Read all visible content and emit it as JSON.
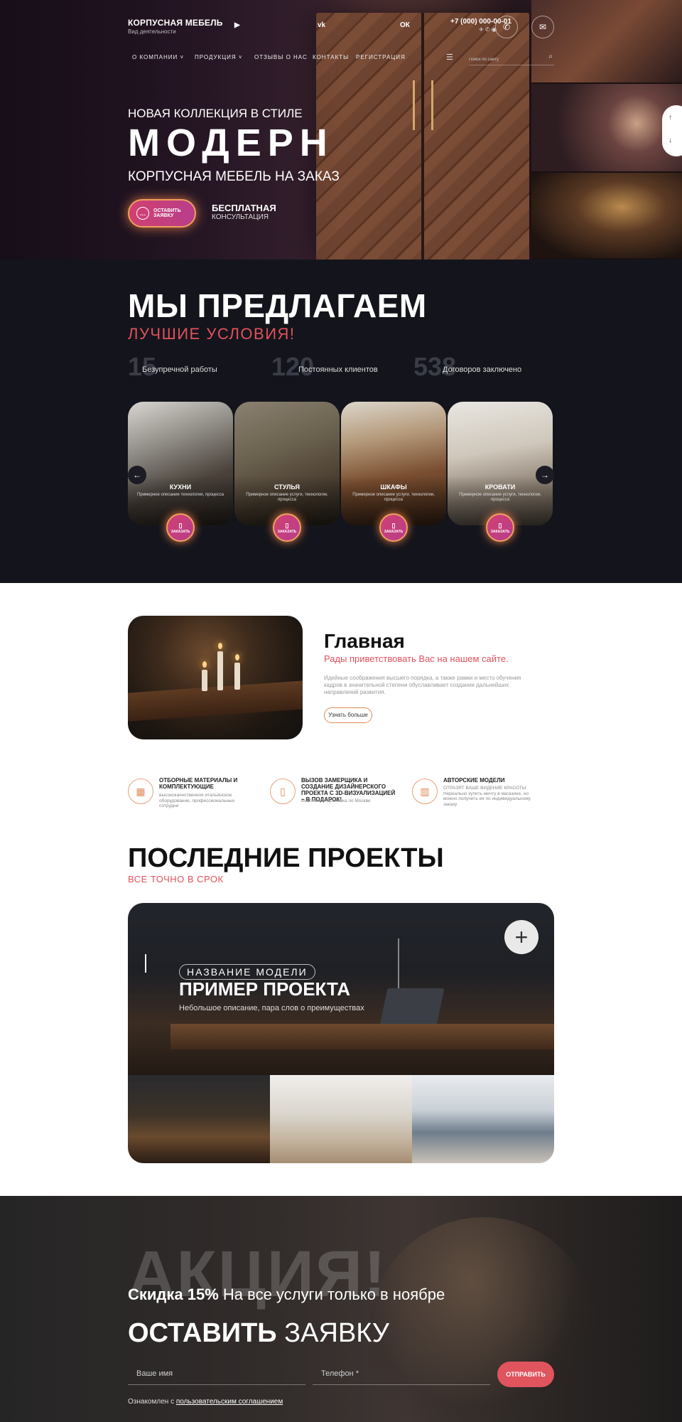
{
  "header": {
    "brand_name": "КОРПУСНАЯ МЕБЕЛЬ",
    "brand_sub": "Вид деятельности",
    "phone": "+7 (000) 000-00-01",
    "nav": [
      "О КОМПАНИИ",
      "ПРОДУКЦИЯ",
      "ОТЗЫВЫ О НАС",
      "КОНТАКТЫ",
      "РЕГИСТРАЦИЯ"
    ],
    "search_placeholder": "Поиск по сайту"
  },
  "hero": {
    "kicker": "НОВАЯ КОЛЛЕКЦИЯ В СТИЛЕ",
    "title": "МОДЕРН",
    "subtitle": "КОРПУСНАЯ МЕБЕЛЬ НА ЗАКАЗ",
    "cta_line1": "ОСТАВИТЬ",
    "cta_line2": "ЗАЯВКУ",
    "consult_line1": "БЕСПЛАТНАЯ",
    "consult_line2": "КОНСУЛЬТАЦИЯ"
  },
  "offer": {
    "title": "МЫ ПРЕДЛАГАЕМ",
    "subtitle": "ЛУЧШИЕ УСЛОВИЯ!",
    "stats": [
      {
        "num": "15",
        "label": "Безупречной работы"
      },
      {
        "num": "120",
        "label": "Постоянных клиентов"
      },
      {
        "num": "538",
        "label": "Договоров заключено"
      }
    ],
    "cards": [
      {
        "title": "КУХНИ",
        "desc": "Примерное описание технологии, процесса",
        "btn": "ЗАКАЗАТЬ"
      },
      {
        "title": "СТУЛЬЯ",
        "desc": "Примерное описание услуги, технологии, процесса",
        "btn": "ЗАКАЗАТЬ"
      },
      {
        "title": "ШКАФЫ",
        "desc": "Примерное описание услуги, технологии, процесса",
        "btn": "ЗАКАЗАТЬ"
      },
      {
        "title": "КРОВАТИ",
        "desc": "Примерное описание услуги, технологии, процесса",
        "btn": "ЗАКАЗАТЬ"
      }
    ]
  },
  "welcome": {
    "title": "Главная",
    "subtitle": "Рады приветствовать Вас на нашем сайте.",
    "text": "Идейные соображения высшего порядка, а также рамки и место обучения кадров в значительной степени обуславливает создании дальнейших направлений развития.",
    "button": "Узнать больше"
  },
  "features": [
    {
      "title": "ОТБОРНЫЕ МАТЕРИАЛЫ И КОМПЛЕКТУЮЩИЕ",
      "sub": "высококачественное итальянское оборудование, профессиональные сотрудни"
    },
    {
      "title": "ВЫЗОВ ЗАМЕРЩИКА И СОЗДАНИЕ ДИЗАЙНЕРСКОГО ПРОЕКТА С 3D-ВИЗУАЛИЗАЦИЕЙ – В ПОДАРОК!",
      "sub": "Бесплатная доставка по Москве"
    },
    {
      "title": "АВТОРСКИЕ МОДЕЛИ",
      "sub": "ОТРАЗЯТ ВАШЕ ВИДЕНИЕ КРАСОТЫ Нереально купить мечту в магазине, но можно получить ее по индивидуальному заказу"
    }
  ],
  "projects": {
    "title": "ПОСЛЕДНИЕ ПРОЕКТЫ",
    "subtitle": "ВСЕ ТОЧНО В СРОК",
    "tag": "НАЗВАНИЕ МОДЕЛИ",
    "name": "ПРИМЕР ПРОЕКТА",
    "desc": "Небольшое описание, пара слов о преимуществах"
  },
  "promo": {
    "big": "АКЦИЯ!",
    "discount_bold": "Скидка 15%",
    "discount_rest": "На все услуги только в ноябре",
    "form_bold": "ОСТАВИТЬ",
    "form_rest": "ЗАЯВКУ",
    "name_placeholder": "Ваше имя",
    "phone_placeholder": "Телефон *",
    "send": "ОТПРАВИТЬ",
    "agree_text": "Ознакомлен с",
    "agree_link": "пользовательским соглашением"
  },
  "colors": {
    "accent": "#e0515c",
    "cta_gradient_start": "#d04070",
    "dark_bg": "#14151c"
  }
}
